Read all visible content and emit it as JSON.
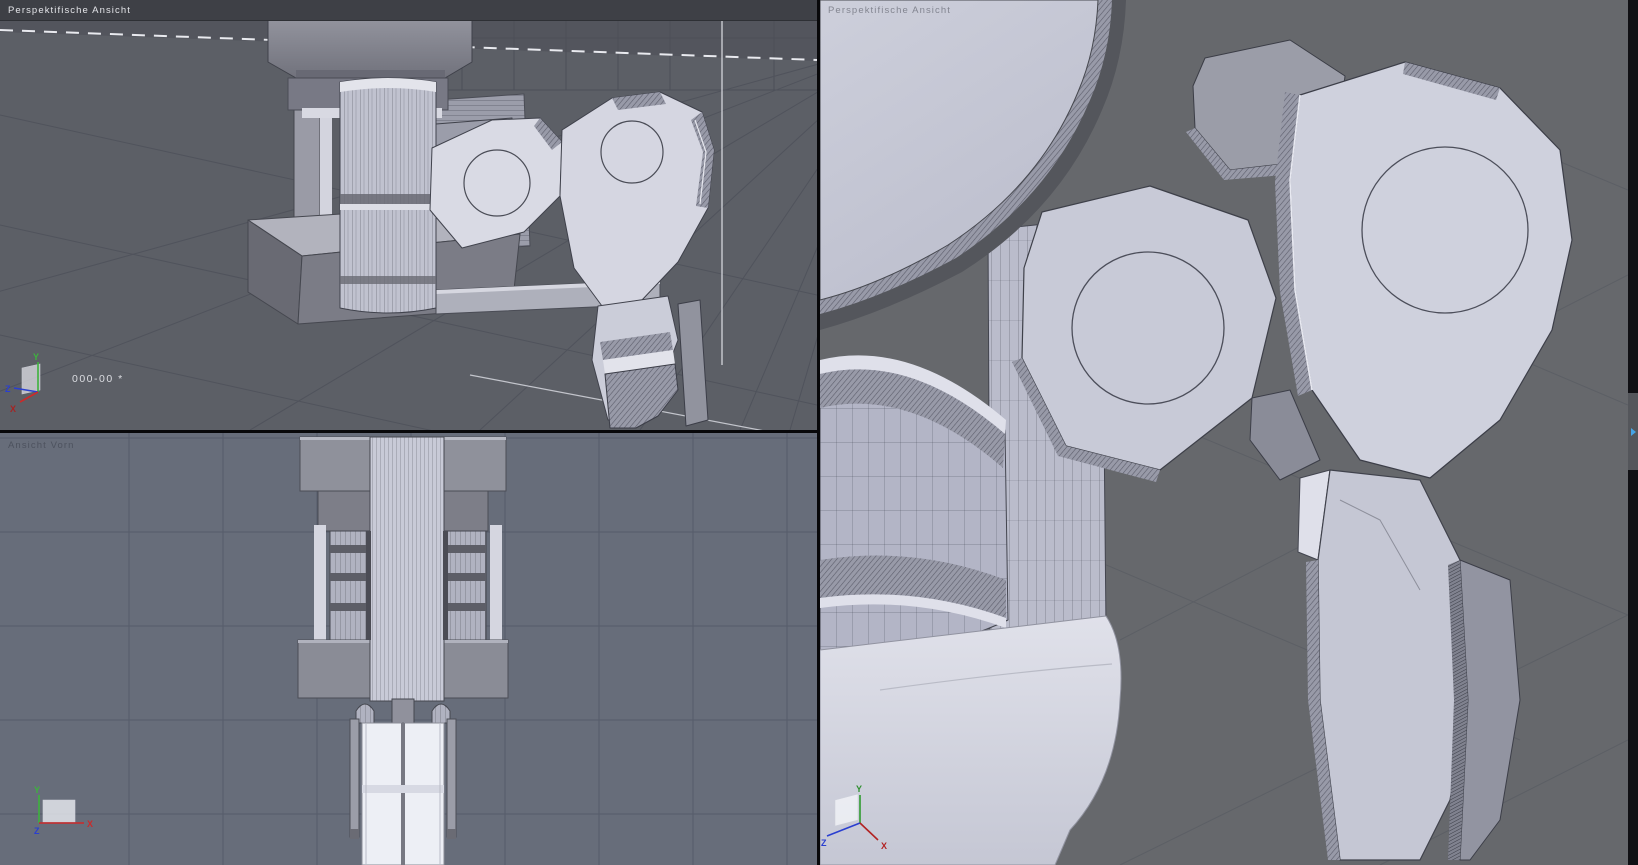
{
  "viewports": {
    "perspective": {
      "label": "Perspektifische Ansicht",
      "angle_readout": "000-00 *",
      "gizmo": {
        "x": "X",
        "y": "Y",
        "z": "Z"
      }
    },
    "front": {
      "label": "Ansicht Vorn",
      "gizmo": {
        "x": "X",
        "y": "Y",
        "z": "Z"
      }
    },
    "detail": {
      "label": "Perspektifische Ansicht",
      "gizmo": {
        "x": "X",
        "y": "Y",
        "z": "Z"
      }
    }
  },
  "panel_tab": {
    "icon": "expand-panel-arrow"
  },
  "colors": {
    "header_bg": "#3e4046",
    "header_text": "#e4e5e9",
    "perspective_sky": "#53555d",
    "perspective_ground": "#5c5f66",
    "front_bg": "#676d7a",
    "front_grid": "#565c6a",
    "detail_ground": "#66686c",
    "model_light": "#d6d7e2",
    "model_mid": "#b7b9c9",
    "model_dark": "#75767f",
    "axis_x": "#cc2a2a",
    "axis_y": "#3db33d",
    "axis_z": "#2a3fd0",
    "panel_arrow": "#46a4e6"
  }
}
